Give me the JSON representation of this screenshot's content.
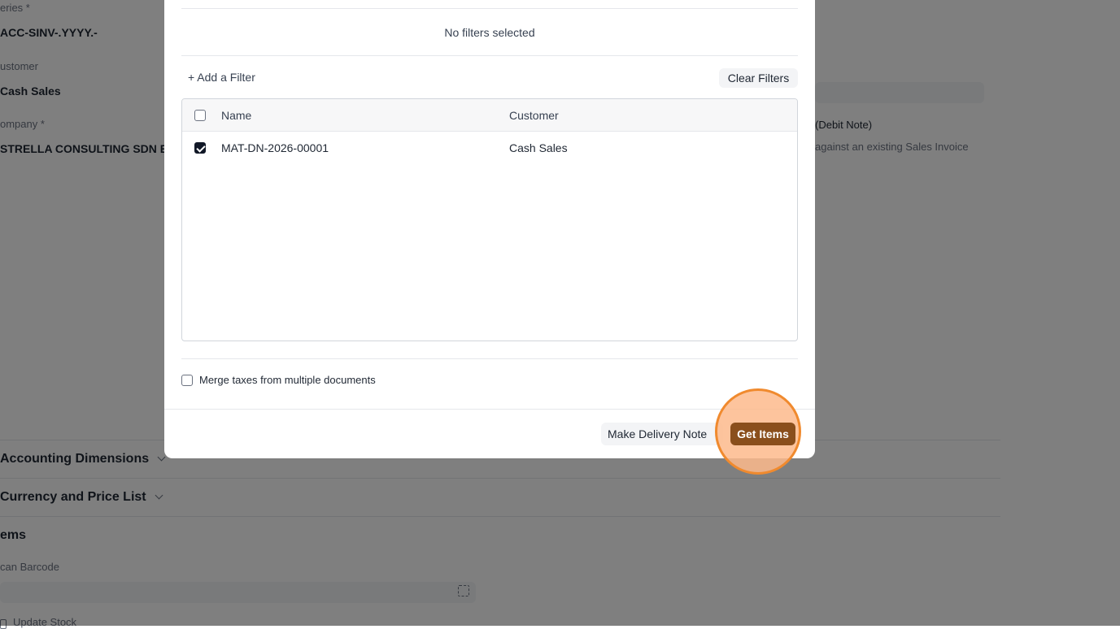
{
  "background": {
    "naming_series_label": "eries *",
    "naming_series_value": "ACC-SINV-.YYYY.-",
    "customer_label": "ustomer",
    "customer_value": "Cash Sales",
    "company_label": "ompany *",
    "company_value": "STRELLA CONSULTING SDN B",
    "debit_note_label": "(Debit Note)",
    "debit_note_help": "against an existing Sales Invoice",
    "sections": {
      "accounting_dimensions": "Accounting Dimensions",
      "currency_price_list": "Currency and Price List",
      "items": "ems"
    },
    "scan_barcode_label": "can Barcode",
    "update_stock_label": "Update Stock"
  },
  "dialog": {
    "no_filters_text": "No filters selected",
    "add_filter_label": "+ Add a Filter",
    "clear_filters_label": "Clear Filters",
    "table": {
      "columns": [
        "Name",
        "Customer"
      ],
      "rows": [
        {
          "name": "MAT-DN-2026-00001",
          "customer": "Cash Sales",
          "selected": true
        }
      ]
    },
    "merge_taxes_label": "Merge taxes from multiple documents",
    "secondary_action_label": "Make Delivery Note",
    "primary_action_label": "Get Items"
  },
  "colors": {
    "primary_button": "#8a4f1c",
    "highlight_fill": "#fdba8c",
    "highlight_ring": "#f08a2e",
    "backdrop": "#000000"
  }
}
